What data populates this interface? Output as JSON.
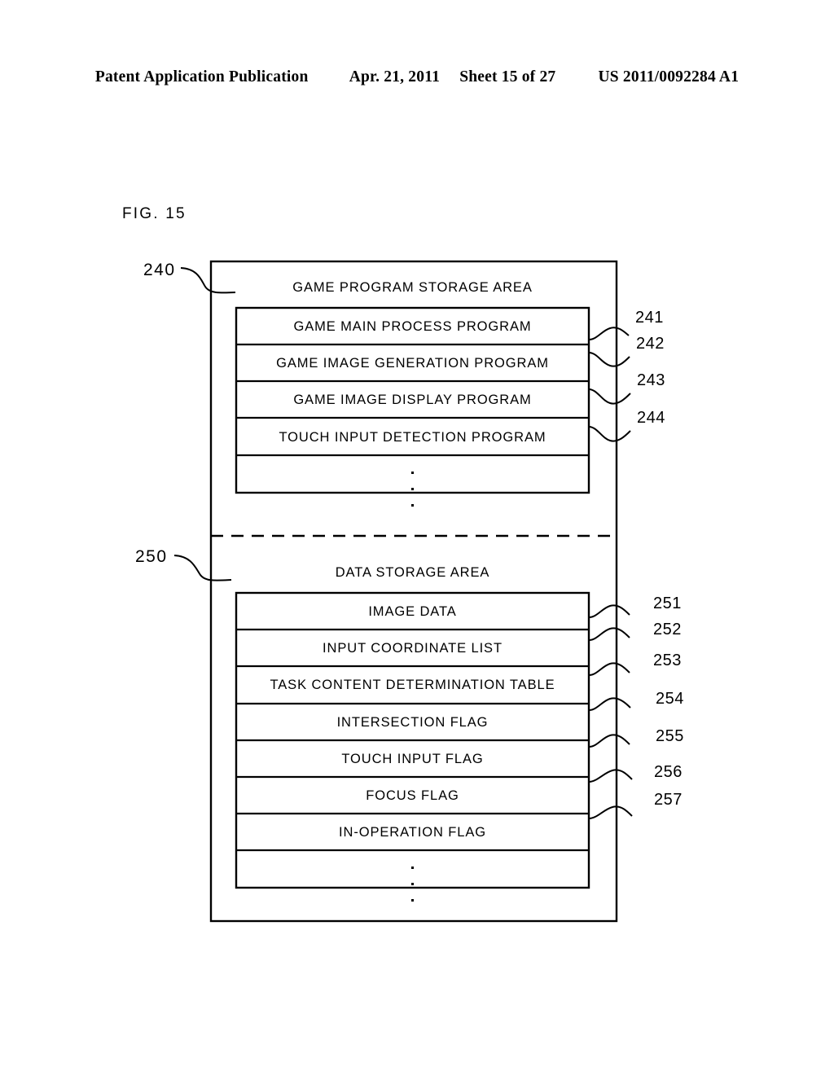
{
  "header": {
    "publication": "Patent Application Publication",
    "date": "Apr. 21, 2011",
    "sheet": "Sheet 15 of 27",
    "patent_number": "US 2011/0092284 A1"
  },
  "figure": {
    "caption": "FIG. 15"
  },
  "diagram": {
    "outer_ref": "240",
    "program_section": {
      "ref": "240",
      "title": "GAME PROGRAM STORAGE AREA",
      "rows": [
        {
          "label": "GAME MAIN PROCESS PROGRAM",
          "ref": "241"
        },
        {
          "label": "GAME IMAGE GENERATION PROGRAM",
          "ref": "242"
        },
        {
          "label": "GAME IMAGE DISPLAY PROGRAM",
          "ref": "243"
        },
        {
          "label": "TOUCH INPUT DETECTION PROGRAM",
          "ref": "244"
        }
      ],
      "ellipsis_row": true
    },
    "data_section": {
      "ref": "250",
      "title": "DATA STORAGE AREA",
      "rows": [
        {
          "label": "IMAGE DATA",
          "ref": "251"
        },
        {
          "label": "INPUT COORDINATE LIST",
          "ref": "252"
        },
        {
          "label": "TASK CONTENT DETERMINATION TABLE",
          "ref": "253"
        },
        {
          "label": "INTERSECTION FLAG",
          "ref": "254"
        },
        {
          "label": "TOUCH INPUT FLAG",
          "ref": "255"
        },
        {
          "label": "FOCUS FLAG",
          "ref": "256"
        },
        {
          "label": "IN-OPERATION FLAG",
          "ref": "257"
        }
      ],
      "ellipsis_row": true
    }
  },
  "colors": {
    "ink": "#000000",
    "paper": "#ffffff"
  }
}
